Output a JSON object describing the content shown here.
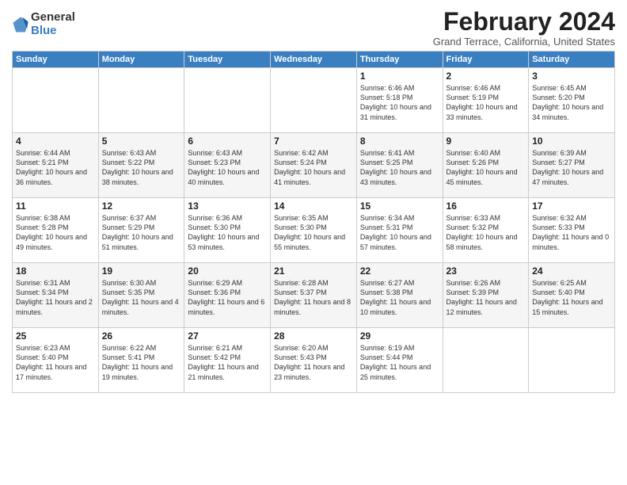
{
  "header": {
    "logo_line1": "General",
    "logo_line2": "Blue",
    "month_title": "February 2024",
    "location": "Grand Terrace, California, United States"
  },
  "weekdays": [
    "Sunday",
    "Monday",
    "Tuesday",
    "Wednesday",
    "Thursday",
    "Friday",
    "Saturday"
  ],
  "weeks": [
    [
      {
        "day": "",
        "content": ""
      },
      {
        "day": "",
        "content": ""
      },
      {
        "day": "",
        "content": ""
      },
      {
        "day": "",
        "content": ""
      },
      {
        "day": "1",
        "content": "Sunrise: 6:46 AM\nSunset: 5:18 PM\nDaylight: 10 hours\nand 31 minutes."
      },
      {
        "day": "2",
        "content": "Sunrise: 6:46 AM\nSunset: 5:19 PM\nDaylight: 10 hours\nand 33 minutes."
      },
      {
        "day": "3",
        "content": "Sunrise: 6:45 AM\nSunset: 5:20 PM\nDaylight: 10 hours\nand 34 minutes."
      }
    ],
    [
      {
        "day": "4",
        "content": "Sunrise: 6:44 AM\nSunset: 5:21 PM\nDaylight: 10 hours\nand 36 minutes."
      },
      {
        "day": "5",
        "content": "Sunrise: 6:43 AM\nSunset: 5:22 PM\nDaylight: 10 hours\nand 38 minutes."
      },
      {
        "day": "6",
        "content": "Sunrise: 6:43 AM\nSunset: 5:23 PM\nDaylight: 10 hours\nand 40 minutes."
      },
      {
        "day": "7",
        "content": "Sunrise: 6:42 AM\nSunset: 5:24 PM\nDaylight: 10 hours\nand 41 minutes."
      },
      {
        "day": "8",
        "content": "Sunrise: 6:41 AM\nSunset: 5:25 PM\nDaylight: 10 hours\nand 43 minutes."
      },
      {
        "day": "9",
        "content": "Sunrise: 6:40 AM\nSunset: 5:26 PM\nDaylight: 10 hours\nand 45 minutes."
      },
      {
        "day": "10",
        "content": "Sunrise: 6:39 AM\nSunset: 5:27 PM\nDaylight: 10 hours\nand 47 minutes."
      }
    ],
    [
      {
        "day": "11",
        "content": "Sunrise: 6:38 AM\nSunset: 5:28 PM\nDaylight: 10 hours\nand 49 minutes."
      },
      {
        "day": "12",
        "content": "Sunrise: 6:37 AM\nSunset: 5:29 PM\nDaylight: 10 hours\nand 51 minutes."
      },
      {
        "day": "13",
        "content": "Sunrise: 6:36 AM\nSunset: 5:30 PM\nDaylight: 10 hours\nand 53 minutes."
      },
      {
        "day": "14",
        "content": "Sunrise: 6:35 AM\nSunset: 5:30 PM\nDaylight: 10 hours\nand 55 minutes."
      },
      {
        "day": "15",
        "content": "Sunrise: 6:34 AM\nSunset: 5:31 PM\nDaylight: 10 hours\nand 57 minutes."
      },
      {
        "day": "16",
        "content": "Sunrise: 6:33 AM\nSunset: 5:32 PM\nDaylight: 10 hours\nand 58 minutes."
      },
      {
        "day": "17",
        "content": "Sunrise: 6:32 AM\nSunset: 5:33 PM\nDaylight: 11 hours\nand 0 minutes."
      }
    ],
    [
      {
        "day": "18",
        "content": "Sunrise: 6:31 AM\nSunset: 5:34 PM\nDaylight: 11 hours\nand 2 minutes."
      },
      {
        "day": "19",
        "content": "Sunrise: 6:30 AM\nSunset: 5:35 PM\nDaylight: 11 hours\nand 4 minutes."
      },
      {
        "day": "20",
        "content": "Sunrise: 6:29 AM\nSunset: 5:36 PM\nDaylight: 11 hours\nand 6 minutes."
      },
      {
        "day": "21",
        "content": "Sunrise: 6:28 AM\nSunset: 5:37 PM\nDaylight: 11 hours\nand 8 minutes."
      },
      {
        "day": "22",
        "content": "Sunrise: 6:27 AM\nSunset: 5:38 PM\nDaylight: 11 hours\nand 10 minutes."
      },
      {
        "day": "23",
        "content": "Sunrise: 6:26 AM\nSunset: 5:39 PM\nDaylight: 11 hours\nand 12 minutes."
      },
      {
        "day": "24",
        "content": "Sunrise: 6:25 AM\nSunset: 5:40 PM\nDaylight: 11 hours\nand 15 minutes."
      }
    ],
    [
      {
        "day": "25",
        "content": "Sunrise: 6:23 AM\nSunset: 5:40 PM\nDaylight: 11 hours\nand 17 minutes."
      },
      {
        "day": "26",
        "content": "Sunrise: 6:22 AM\nSunset: 5:41 PM\nDaylight: 11 hours\nand 19 minutes."
      },
      {
        "day": "27",
        "content": "Sunrise: 6:21 AM\nSunset: 5:42 PM\nDaylight: 11 hours\nand 21 minutes."
      },
      {
        "day": "28",
        "content": "Sunrise: 6:20 AM\nSunset: 5:43 PM\nDaylight: 11 hours\nand 23 minutes."
      },
      {
        "day": "29",
        "content": "Sunrise: 6:19 AM\nSunset: 5:44 PM\nDaylight: 11 hours\nand 25 minutes."
      },
      {
        "day": "",
        "content": ""
      },
      {
        "day": "",
        "content": ""
      }
    ]
  ]
}
